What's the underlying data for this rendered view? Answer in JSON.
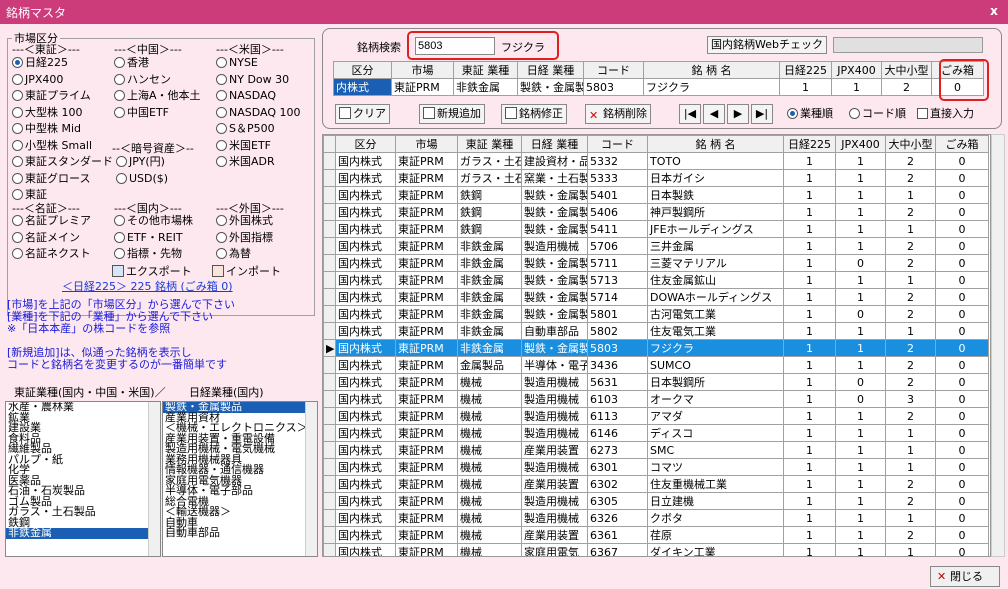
{
  "window": {
    "title": "銘柄マスタ",
    "close": "x"
  },
  "market": {
    "title": "市場区分",
    "h_tse": "---＜東証＞---",
    "h_china": "---＜中国＞---",
    "h_us": "---＜米国＞---",
    "col1": [
      "日経225",
      "JPX400",
      "東証プライム",
      "大型株 100",
      "中型株 Mid",
      "小型株 Small",
      "東証スタンダード",
      "東証グロース",
      "東証"
    ],
    "col2": [
      "香港",
      "ハンセン",
      "上海A・他本土",
      "中国ETF"
    ],
    "col3": [
      "NYSE",
      "NY Dow 30",
      "NASDAQ",
      "NASDAQ 100",
      "S＆P500",
      "米国ETF",
      "米国ADR"
    ],
    "h_crypto": "--＜暗号資産＞--",
    "crypto": [
      "JPY(円)",
      "USD($)"
    ],
    "h_name": "---＜名証＞---",
    "h_dom": "---＜国内＞---",
    "h_foreign": "---＜外国＞---",
    "name": [
      "名証プレミア",
      "名証メイン",
      "名証ネクスト"
    ],
    "dom": [
      "その他市場株",
      "ETF・REIT",
      "指標・先物"
    ],
    "foreign": [
      "外国株式",
      "外国指標",
      "為替"
    ],
    "export": "エクスポート",
    "import": "インポート",
    "summary": "＜日経225＞ 225 銘柄 (ごみ箱 0)"
  },
  "notes": [
    "[市場]を上記の「市場区分」から選んで下さい",
    "[業種]を下記の「業種」から選んで下さい",
    "※「日本本産」の株コードを参照",
    "",
    "[新規追加]は、似通った銘柄を表示し",
    "コードと銘柄名を変更するのが一番簡単です"
  ],
  "sector_labels": {
    "left": "東証業種(国内・中国・米国)／",
    "right": "日経業種(国内)"
  },
  "tse_sectors": [
    "水産・農林業",
    "鉱業",
    "建設業",
    "食料品",
    "繊維製品",
    "パルプ・紙",
    "化学",
    "医薬品",
    "石油・石炭製品",
    "ゴム製品",
    "ガラス・土石製品",
    "鉄鋼",
    "非鉄金属"
  ],
  "nikkei_sectors": [
    "製鉄・金属製品",
    "産業用資材",
    "＜機械・エレクトロニクス＞",
    "産業用装置・重電設備",
    "製造用機械・電気機械",
    "業務用機械器具",
    "情報機器・通信機器",
    "家庭用電気機器",
    "半導体・電子部品",
    "総合電機",
    "＜輸送機器＞",
    "自動車",
    "自動車部品"
  ],
  "search": {
    "label": "銘柄検索",
    "value": "5803",
    "result": "フジクラ",
    "web_check": "国内銘柄Webチェック"
  },
  "edit_headers": [
    "区分",
    "市場",
    "東証 業種",
    "日経 業種",
    "コード",
    "銘 柄 名",
    "日経225",
    "JPX400",
    "大中小型",
    "ごみ箱"
  ],
  "edit_row": [
    "内株式",
    "東証PRM",
    "非鉄金属",
    "製鉄・金属製",
    "5803",
    "フジクラ",
    "1",
    "1",
    "2",
    "0"
  ],
  "buttons": {
    "clear": "クリア",
    "add": "新規追加",
    "edit": "銘柄修正",
    "delete": "銘柄削除",
    "first": "|◀",
    "prev": "◀",
    "next": "▶",
    "last": "▶|",
    "sort_sector": "業種順",
    "sort_code": "コード順",
    "direct": "直接入力",
    "close": "閉じる"
  },
  "table_headers": [
    "区分",
    "市場",
    "東証 業種",
    "日経 業種",
    "コード",
    "銘 柄 名",
    "日経225",
    "JPX400",
    "大中小型",
    "ごみ箱"
  ],
  "rows": [
    [
      "国内株式",
      "東証PRM",
      "ガラス・土石",
      "建設資材・品",
      "5332",
      "TOTO",
      "1",
      "1",
      "2",
      "0"
    ],
    [
      "国内株式",
      "東証PRM",
      "ガラス・土石",
      "窯業・土石製",
      "5333",
      "日本ガイシ",
      "1",
      "1",
      "2",
      "0"
    ],
    [
      "国内株式",
      "東証PRM",
      "鉄鋼",
      "製鉄・金属製",
      "5401",
      "日本製鉄",
      "1",
      "1",
      "1",
      "0"
    ],
    [
      "国内株式",
      "東証PRM",
      "鉄鋼",
      "製鉄・金属製",
      "5406",
      "神戸製鋼所",
      "1",
      "1",
      "2",
      "0"
    ],
    [
      "国内株式",
      "東証PRM",
      "鉄鋼",
      "製鉄・金属製",
      "5411",
      "JFEホールディングス",
      "1",
      "1",
      "1",
      "0"
    ],
    [
      "国内株式",
      "東証PRM",
      "非鉄金属",
      "製造用機械",
      "5706",
      "三井金属",
      "1",
      "1",
      "2",
      "0"
    ],
    [
      "国内株式",
      "東証PRM",
      "非鉄金属",
      "製鉄・金属製",
      "5711",
      "三菱マテリアル",
      "1",
      "0",
      "2",
      "0"
    ],
    [
      "国内株式",
      "東証PRM",
      "非鉄金属",
      "製鉄・金属製",
      "5713",
      "住友金属鉱山",
      "1",
      "1",
      "1",
      "0"
    ],
    [
      "国内株式",
      "東証PRM",
      "非鉄金属",
      "製鉄・金属製",
      "5714",
      "DOWAホールディングス",
      "1",
      "1",
      "2",
      "0"
    ],
    [
      "国内株式",
      "東証PRM",
      "非鉄金属",
      "製鉄・金属製",
      "5801",
      "古河電気工業",
      "1",
      "0",
      "2",
      "0"
    ],
    [
      "国内株式",
      "東証PRM",
      "非鉄金属",
      "自動車部品",
      "5802",
      "住友電気工業",
      "1",
      "1",
      "1",
      "0"
    ],
    [
      "国内株式",
      "東証PRM",
      "非鉄金属",
      "製鉄・金属製",
      "5803",
      "フジクラ",
      "1",
      "1",
      "2",
      "0"
    ],
    [
      "国内株式",
      "東証PRM",
      "金属製品",
      "半導体・電子",
      "3436",
      "SUMCO",
      "1",
      "1",
      "2",
      "0"
    ],
    [
      "国内株式",
      "東証PRM",
      "機械",
      "製造用機械",
      "5631",
      "日本製鋼所",
      "1",
      "0",
      "2",
      "0"
    ],
    [
      "国内株式",
      "東証PRM",
      "機械",
      "製造用機械",
      "6103",
      "オークマ",
      "1",
      "0",
      "3",
      "0"
    ],
    [
      "国内株式",
      "東証PRM",
      "機械",
      "製造用機械",
      "6113",
      "アマダ",
      "1",
      "1",
      "2",
      "0"
    ],
    [
      "国内株式",
      "東証PRM",
      "機械",
      "製造用機械",
      "6146",
      "ディスコ",
      "1",
      "1",
      "1",
      "0"
    ],
    [
      "国内株式",
      "東証PRM",
      "機械",
      "産業用装置",
      "6273",
      "SMC",
      "1",
      "1",
      "1",
      "0"
    ],
    [
      "国内株式",
      "東証PRM",
      "機械",
      "製造用機械",
      "6301",
      "コマツ",
      "1",
      "1",
      "1",
      "0"
    ],
    [
      "国内株式",
      "東証PRM",
      "機械",
      "産業用装置",
      "6302",
      "住友重機械工業",
      "1",
      "1",
      "2",
      "0"
    ],
    [
      "国内株式",
      "東証PRM",
      "機械",
      "製造用機械",
      "6305",
      "日立建機",
      "1",
      "1",
      "2",
      "0"
    ],
    [
      "国内株式",
      "東証PRM",
      "機械",
      "製造用機械",
      "6326",
      "クボタ",
      "1",
      "1",
      "1",
      "0"
    ],
    [
      "国内株式",
      "東証PRM",
      "機械",
      "産業用装置",
      "6361",
      "荏原",
      "1",
      "1",
      "2",
      "0"
    ],
    [
      "国内株式",
      "東証PRM",
      "機械",
      "家庭用電気",
      "6367",
      "ダイキン工業",
      "1",
      "1",
      "1",
      "0"
    ]
  ],
  "selected_row": 11,
  "colors": {
    "title": "#cc3b7a",
    "bg": "#fde8f0",
    "select": "#1a5fb4",
    "highlight": "#e02020"
  }
}
